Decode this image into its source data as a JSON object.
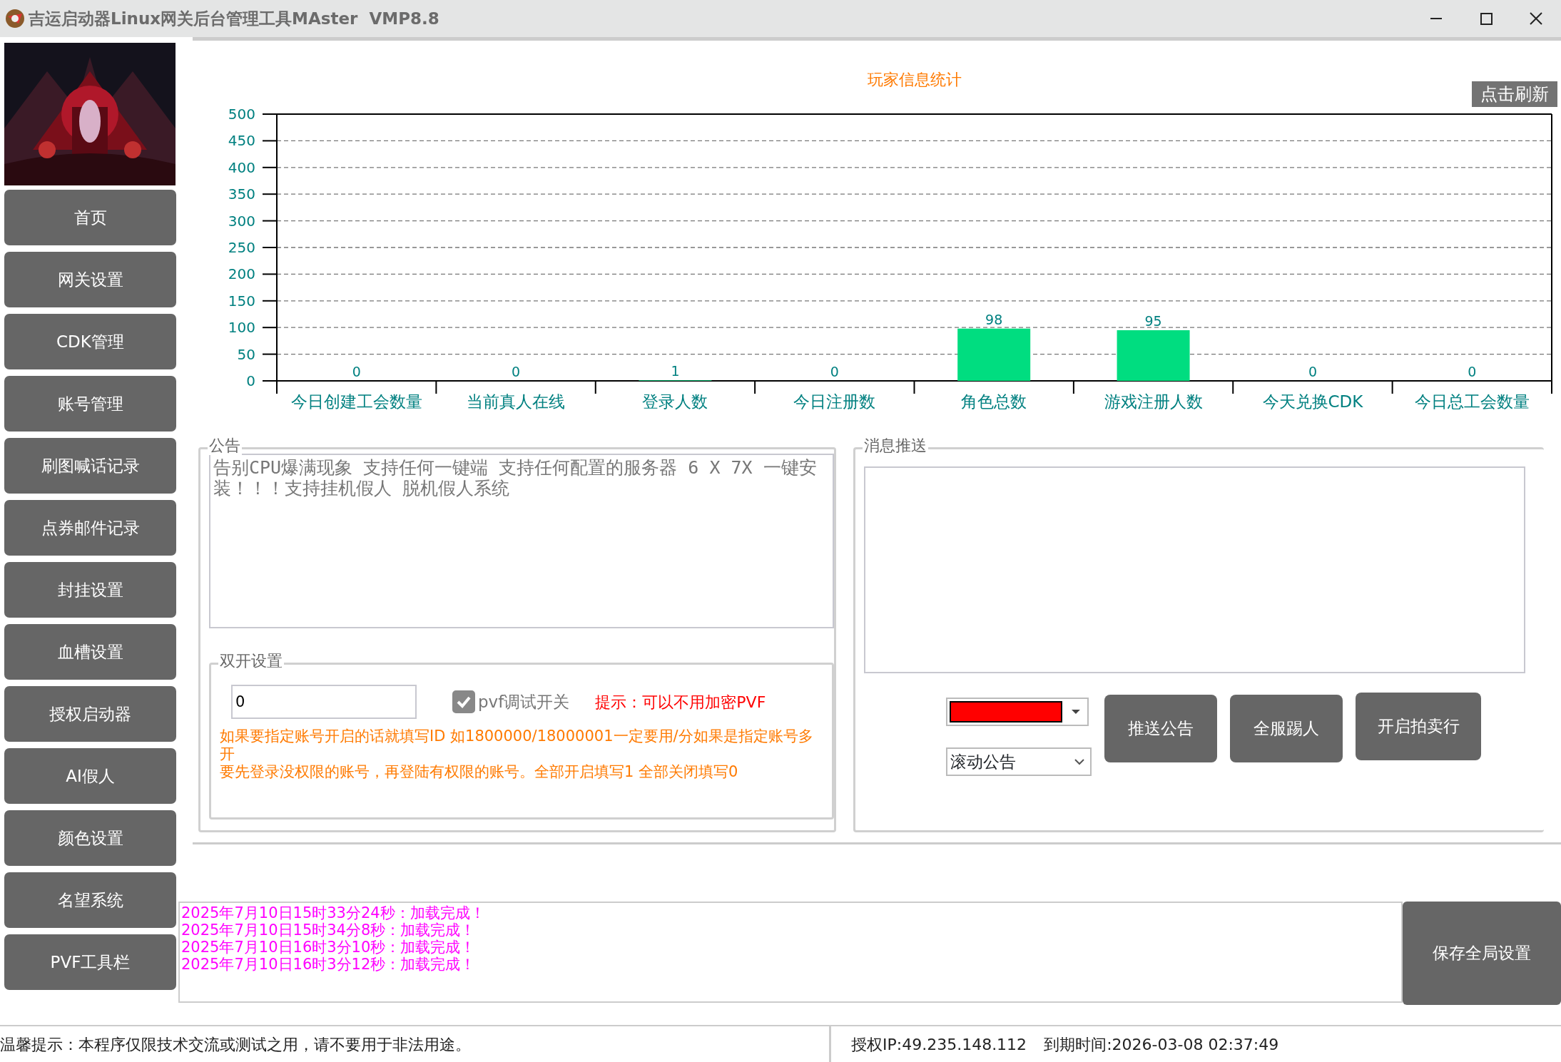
{
  "window": {
    "title": "吉运启动器Linux网关后台管理工具MAster  VMP8.8"
  },
  "sidebar": {
    "items": [
      {
        "label": "首页"
      },
      {
        "label": "网关设置"
      },
      {
        "label": "CDK管理"
      },
      {
        "label": "账号管理"
      },
      {
        "label": "刷图喊话记录"
      },
      {
        "label": "点券邮件记录"
      },
      {
        "label": "封挂设置"
      },
      {
        "label": "血槽设置"
      },
      {
        "label": "授权启动器"
      },
      {
        "label": "AI假人"
      },
      {
        "label": "颜色设置"
      },
      {
        "label": "名望系统"
      },
      {
        "label": "PVF工具栏"
      }
    ]
  },
  "chart_panel": {
    "refresh_button": "点击刷新",
    "chart_data": {
      "type": "bar",
      "title": "玩家信息统计",
      "categories": [
        "今日创建工会数量",
        "当前真人在线",
        "登录人数",
        "今日注册数",
        "角色总数",
        "游戏注册人数",
        "今天兑换CDK",
        "今日总工会数量"
      ],
      "series": [
        {
          "color": "#00dd80",
          "values": [
            0,
            0,
            1,
            0,
            98,
            95,
            0,
            0
          ]
        }
      ],
      "ylim": [
        0,
        500
      ],
      "grid": true,
      "yticks": [
        0,
        50,
        100,
        150,
        200,
        250,
        300,
        350,
        400,
        450,
        500
      ],
      "data_labels": true
    }
  },
  "announcement": {
    "legend": "公告",
    "text": "告别CPU爆满现象 支持任何一键端 支持任何配置的服务器 6 X 7X 一键安装！！！支持挂机假人 脱机假人系统"
  },
  "dual_open": {
    "legend": "双开设置",
    "value": "0",
    "checkbox": {
      "label": "pvf调试开关",
      "checked": true
    },
    "hint": "提示：可以不用加密PVF",
    "notes": [
      "如果要指定账号开启的话就填写ID 如1800000/18000001一定要用/分如果是指定账号多开",
      "要先登录没权限的账号，再登陆有权限的账号。全部开启填写1 全部关闭填写0"
    ]
  },
  "message_push": {
    "legend": "消息推送",
    "color_select": {
      "color": "#ff0000"
    },
    "type_select": "滚动公告",
    "buttons": [
      "推送公告",
      "全服踢人",
      "开启拍卖行"
    ]
  },
  "log": [
    "2025年7月10日15时33分24秒：加载完成！",
    "2025年7月10日15时34分8秒：加载完成！",
    "2025年7月10日16时3分10秒：加载完成！",
    "2025年7月10日16时3分12秒：加载完成！"
  ],
  "save_button": "保存全局设置",
  "status_bar": {
    "notice": "温馨提示：本程序仅限技术交流或测试之用，请不要用于非法用途。",
    "license": "授权IP:49.235.148.112",
    "expiry": "到期时间:2026-03-08 02:37:49"
  }
}
